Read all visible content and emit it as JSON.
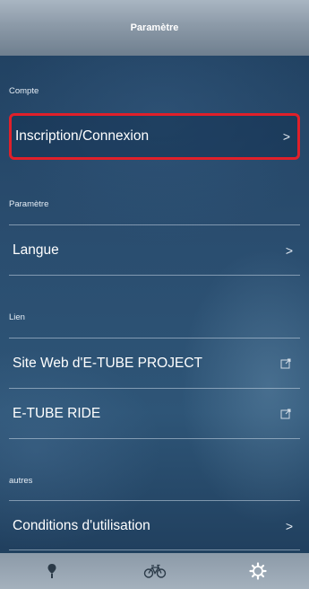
{
  "header": {
    "title": "Paramètre"
  },
  "sections": {
    "account": {
      "label": "Compte",
      "items": [
        {
          "label": "Inscription/Connexion",
          "icon": "chevron-right-icon"
        }
      ]
    },
    "settings": {
      "label": "Paramètre",
      "items": [
        {
          "label": "Langue",
          "icon": "chevron-right-icon"
        }
      ]
    },
    "links": {
      "label": "Lien",
      "items": [
        {
          "label": "Site Web d'E-TUBE PROJECT",
          "icon": "external-link-icon"
        },
        {
          "label": "E-TUBE RIDE",
          "icon": "external-link-icon"
        }
      ]
    },
    "others": {
      "label": "autres",
      "items": [
        {
          "label": "Conditions d'utilisation",
          "icon": "chevron-right-icon"
        }
      ]
    }
  },
  "chevron_glyph": ">",
  "bottom_nav": [
    {
      "name": "map-pin-icon",
      "active": false
    },
    {
      "name": "bicycle-icon",
      "active": false
    },
    {
      "name": "settings-gear-icon",
      "active": true
    }
  ],
  "colors": {
    "highlight_border": "#e0202a",
    "nav_bg": "#99a6b3"
  }
}
